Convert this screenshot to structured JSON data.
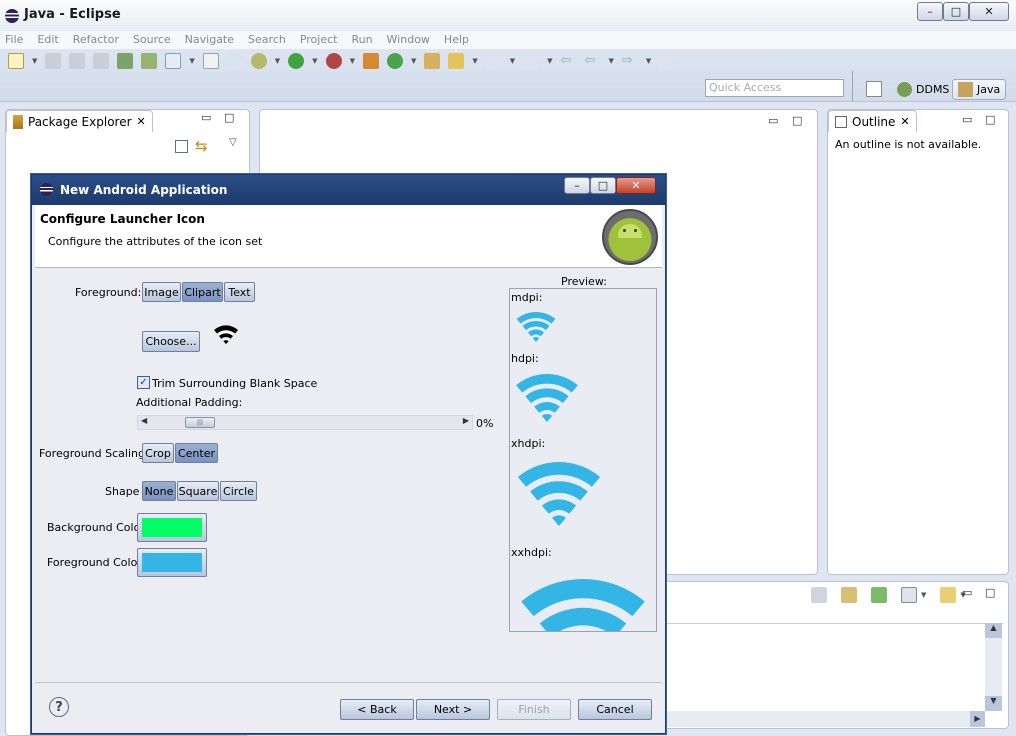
{
  "window": {
    "title": "Java - Eclipse",
    "min": "–",
    "max": "□",
    "close": "✕"
  },
  "menu": [
    "File",
    "Edit",
    "Refactor",
    "Source",
    "Navigate",
    "Search",
    "Project",
    "Run",
    "Window",
    "Help"
  ],
  "toolbar": {
    "quick_access_placeholder": "Quick Access"
  },
  "perspectives": {
    "ddms": "DDMS",
    "java": "Java"
  },
  "package_explorer": {
    "title": "Package Explorer"
  },
  "outline": {
    "title": "Outline",
    "message": "An outline is not available."
  },
  "dialog": {
    "title": "New Android Application",
    "heading": "Configure Launcher Icon",
    "subheading": "Configure the attributes of the icon set",
    "foreground_label": "Foreground:",
    "foreground_options": [
      "Image",
      "Clipart",
      "Text"
    ],
    "foreground_selected": "Clipart",
    "choose_button": "Choose...",
    "trim_label": "Trim Surrounding Blank Space",
    "trim_checked": true,
    "padding_label": "Additional Padding:",
    "padding_value": "0%",
    "padding_level": 0,
    "scaling_label": "Foreground Scaling:",
    "scaling_options": [
      "Crop",
      "Center"
    ],
    "scaling_selected": "Center",
    "shape_label": "Shape",
    "shape_options": [
      "None",
      "Square",
      "Circle"
    ],
    "shape_selected": "None",
    "bg_color_label": "Background Color:",
    "bg_color": "#00ff66",
    "fg_color_label": "Foreground Color:",
    "fg_color": "#33b5e5",
    "preview_label": "Preview:",
    "preview_densities": [
      "mdpi:",
      "hdpi:",
      "xhdpi:",
      "xxhdpi:"
    ],
    "buttons": {
      "back": "< Back",
      "next": "Next >",
      "finish": "Finish",
      "cancel": "Cancel"
    },
    "help": "?"
  },
  "icons": [
    "eclipse-logo-icon",
    "package-explorer-icon",
    "outline-icon",
    "android-icon",
    "wifi-clipart-icon",
    "help-icon"
  ]
}
